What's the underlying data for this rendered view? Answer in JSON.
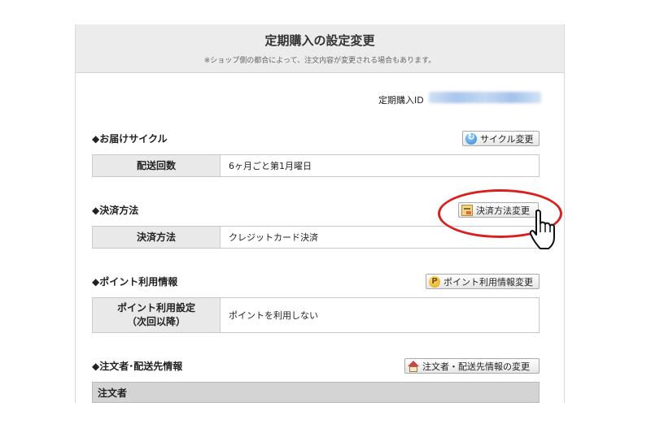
{
  "header": {
    "title": "定期購入の設定変更",
    "note": "※ショップ側の都合によって、注文内容が変更される場合もあります。"
  },
  "subscription_id": {
    "label": "定期購入ID",
    "value": ""
  },
  "sections": {
    "delivery_cycle": {
      "title": "◆お届けサイクル",
      "button_label": "サイクル変更",
      "row_label": "配送回数",
      "row_value": "6ヶ月ごと第1月曜日"
    },
    "payment": {
      "title": "◆決済方法",
      "button_label": "決済方法変更",
      "row_label": "決済方法",
      "row_value": "クレジットカード決済"
    },
    "points": {
      "title": "◆ポイント利用情報",
      "button_label": "ポイント利用情報変更",
      "row_label_line1": "ポイント利用設定",
      "row_label_line2": "（次回以降）",
      "row_value": "ポイントを利用しない"
    },
    "orderer": {
      "title": "◆注文者･配送先情報",
      "button_label": "注文者・配送先情報の変更",
      "subheader": "注文者"
    }
  },
  "icons": {
    "cycle_button": "refresh-icon",
    "payment_button": "card-icon",
    "points_button": "point-coin-icon",
    "orderer_button": "house-icon"
  },
  "colors": {
    "highlight_circle": "#d82020"
  }
}
